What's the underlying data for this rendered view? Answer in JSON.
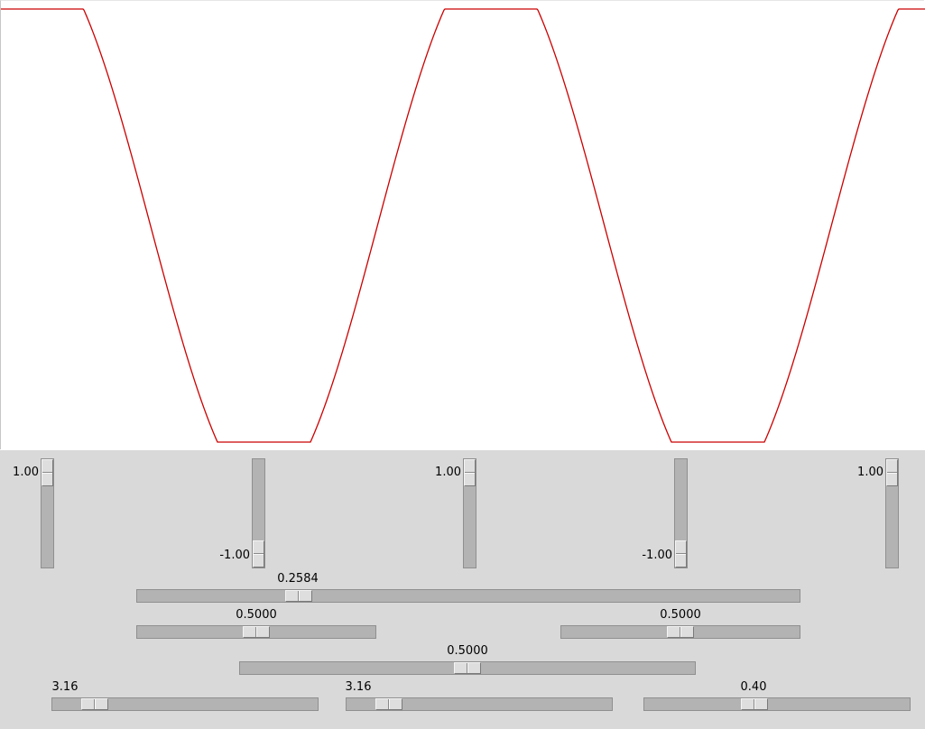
{
  "plot": {
    "curve_color": "#cc0000",
    "background": "#ffffff",
    "value_range": [
      -1.0,
      1.0
    ],
    "shape": "clipped-cosine",
    "cycles_visible": 2
  },
  "vertical_sliders": [
    {
      "value_label": "1.00",
      "value": 1.0,
      "min": -1.0,
      "max": 1.0
    },
    {
      "value_label": "-1.00",
      "value": -1.0,
      "min": -1.0,
      "max": 1.0
    },
    {
      "value_label": "1.00",
      "value": 1.0,
      "min": -1.0,
      "max": 1.0
    },
    {
      "value_label": "-1.00",
      "value": -1.0,
      "min": -1.0,
      "max": 1.0
    },
    {
      "value_label": "1.00",
      "value": 1.0,
      "min": -1.0,
      "max": 1.0
    }
  ],
  "horizontal_sliders": [
    {
      "value_label": "0.2584",
      "fraction": 0.248
    },
    {
      "value_label": "0.5000",
      "fraction": 0.5
    },
    {
      "value_label": "0.5000",
      "fraction": 0.5
    },
    {
      "value_label": "0.5000",
      "fraction": 0.5
    },
    {
      "value_label": "3.16",
      "fraction": 0.12
    },
    {
      "value_label": "3.16",
      "fraction": 0.12
    },
    {
      "value_label": "0.40",
      "fraction": 0.41
    }
  ]
}
